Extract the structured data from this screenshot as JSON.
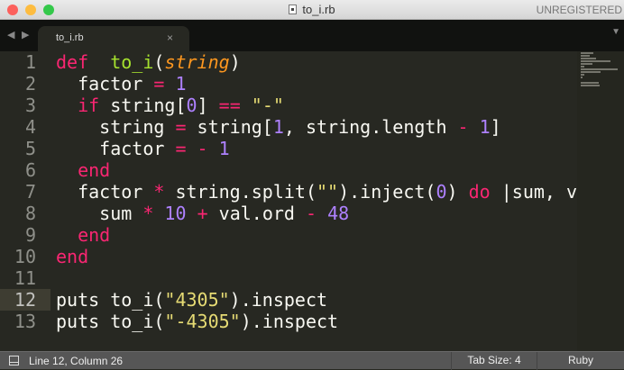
{
  "window": {
    "title": "to_i.rb",
    "registration": "UNREGISTERED"
  },
  "tabs": [
    {
      "label": "to_i.rb",
      "close": "×"
    }
  ],
  "nav": {
    "back": "◀",
    "forward": "▶",
    "menu": "▼"
  },
  "editor": {
    "current_line": 12,
    "line_numbers": [
      "1",
      "2",
      "3",
      "4",
      "5",
      "6",
      "7",
      "8",
      "9",
      "10",
      "11",
      "12",
      "13"
    ],
    "lines": [
      [
        [
          "kw",
          "def"
        ],
        [
          "",
          "  "
        ],
        [
          "fn",
          "to_i"
        ],
        [
          "",
          "("
        ],
        [
          "param",
          "string"
        ],
        [
          "",
          ")"
        ]
      ],
      [
        [
          "",
          "  factor "
        ],
        [
          "kw",
          "="
        ],
        [
          "",
          " "
        ],
        [
          "num",
          "1"
        ]
      ],
      [
        [
          "",
          "  "
        ],
        [
          "kw",
          "if"
        ],
        [
          "",
          " string["
        ],
        [
          "num",
          "0"
        ],
        [
          "",
          "] "
        ],
        [
          "kw",
          "=="
        ],
        [
          "",
          " "
        ],
        [
          "str",
          "\"-\""
        ]
      ],
      [
        [
          "",
          "    string "
        ],
        [
          "kw",
          "="
        ],
        [
          "",
          " string["
        ],
        [
          "num",
          "1"
        ],
        [
          "",
          ", string.length "
        ],
        [
          "kw",
          "-"
        ],
        [
          "",
          " "
        ],
        [
          "num",
          "1"
        ],
        [
          "",
          "]"
        ]
      ],
      [
        [
          "",
          "    factor "
        ],
        [
          "kw",
          "="
        ],
        [
          "",
          " "
        ],
        [
          "kw",
          "-"
        ],
        [
          "",
          " "
        ],
        [
          "num",
          "1"
        ]
      ],
      [
        [
          "",
          "  "
        ],
        [
          "kw",
          "end"
        ]
      ],
      [
        [
          "",
          "  factor "
        ],
        [
          "kw",
          "*"
        ],
        [
          "",
          " string.split("
        ],
        [
          "str",
          "\"\""
        ],
        [
          "",
          ").inject("
        ],
        [
          "num",
          "0"
        ],
        [
          "",
          ") "
        ],
        [
          "kw",
          "do"
        ],
        [
          "",
          " |sum, val|"
        ]
      ],
      [
        [
          "",
          "    sum "
        ],
        [
          "kw",
          "*"
        ],
        [
          "",
          " "
        ],
        [
          "num",
          "10"
        ],
        [
          "",
          " "
        ],
        [
          "kw",
          "+"
        ],
        [
          "",
          " val.ord "
        ],
        [
          "kw",
          "-"
        ],
        [
          "",
          " "
        ],
        [
          "num",
          "48"
        ]
      ],
      [
        [
          "",
          "  "
        ],
        [
          "kw",
          "end"
        ]
      ],
      [
        [
          "kw",
          "end"
        ]
      ],
      [],
      [
        [
          "",
          "puts to_i("
        ],
        [
          "str",
          "\"4305\""
        ],
        [
          "",
          ").inspect"
        ]
      ],
      [
        [
          "",
          "puts to_i("
        ],
        [
          "str",
          "\"-4305\""
        ],
        [
          "",
          ").inspect"
        ]
      ]
    ]
  },
  "status": {
    "position": "Line 12, Column 26",
    "tab_size": "Tab Size: 4",
    "syntax": "Ruby"
  },
  "colors": {
    "keyword": "#f92672",
    "function": "#a6e22e",
    "parameter": "#fd971f",
    "number": "#ae81ff",
    "string": "#e6db74",
    "background": "#272822"
  }
}
